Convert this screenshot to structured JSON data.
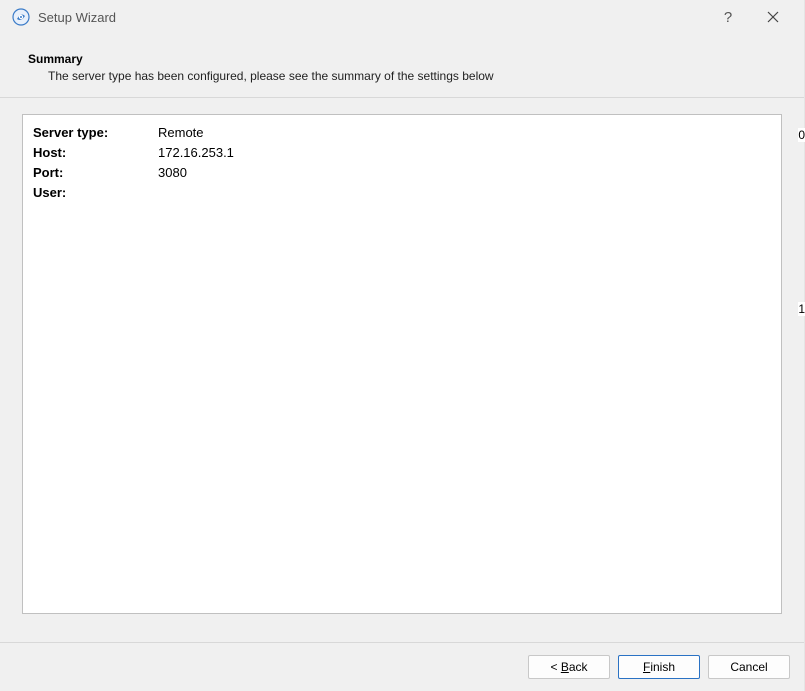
{
  "titlebar": {
    "title": "Setup Wizard",
    "help_label": "?",
    "close_label": "Close"
  },
  "header": {
    "heading": "Summary",
    "subtext": "The server type has been configured, please see the summary of the settings below"
  },
  "summary": {
    "rows": [
      {
        "label": "Server type:",
        "value": "Remote"
      },
      {
        "label": "Host:",
        "value": "172.16.253.1"
      },
      {
        "label": "Port:",
        "value": "3080"
      },
      {
        "label": "User:",
        "value": ""
      }
    ]
  },
  "footer": {
    "back_label": "< Back",
    "finish_label": "Finish",
    "cancel_label": "Cancel"
  },
  "edge": {
    "d0": "0",
    "d1": "1"
  }
}
